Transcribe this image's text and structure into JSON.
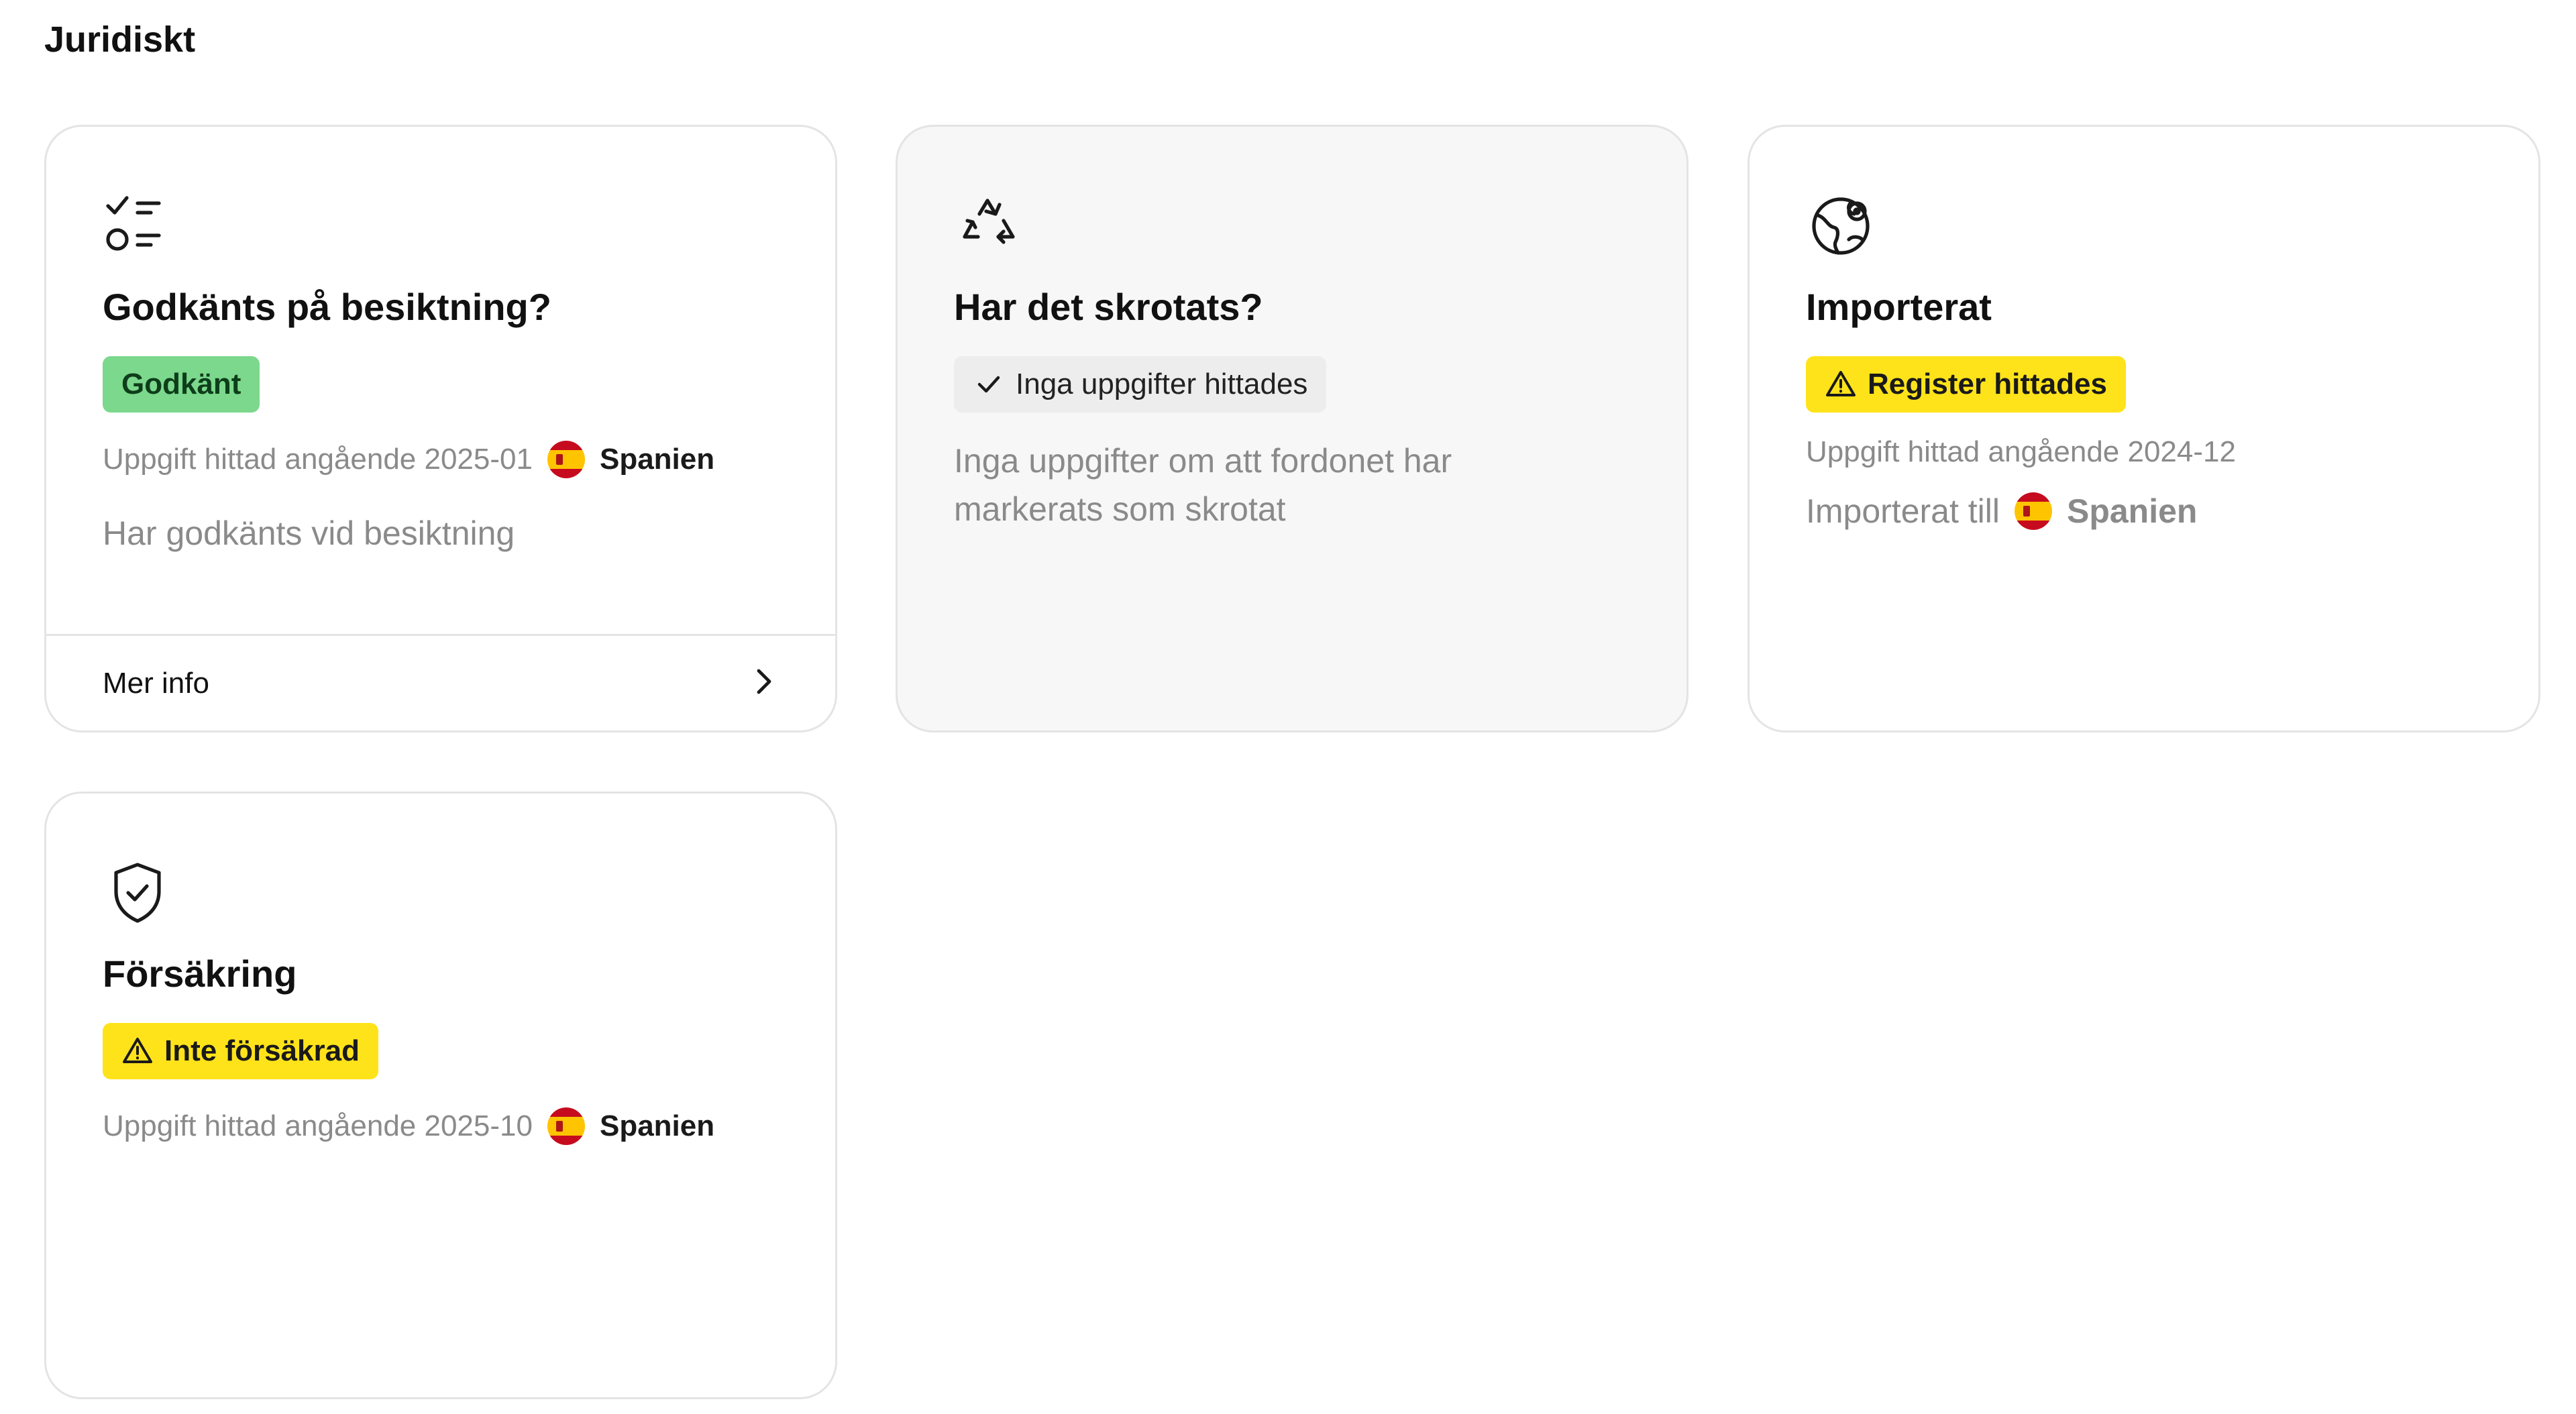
{
  "section": {
    "title": "Juridiskt"
  },
  "cards": [
    {
      "icon": "checklist-icon",
      "title": "Godkänts på besiktning?",
      "badge": "Godkänt",
      "meta_label": "Uppgift hittad angående 2025-01",
      "meta_country": "Spanien",
      "description": "Har godkänts vid besiktning",
      "footer_label": "Mer info"
    },
    {
      "icon": "recycle-icon",
      "title": "Har det skrotats?",
      "badge": "Inga uppgifter hittades",
      "description_line1": "Inga uppgifter om att fordonet har",
      "description_line2": "markerats som skrotat"
    },
    {
      "icon": "globe-icon",
      "title": "Importerat",
      "badge": "Register hittades",
      "meta_label": "Uppgift hittad angående 2024-12",
      "imported_label": "Importerat till",
      "imported_country": "Spanien"
    },
    {
      "icon": "shield-check-icon",
      "title": "Försäkring",
      "badge": "Inte försäkrad",
      "meta_label": "Uppgift hittad angående 2025-10",
      "meta_country": "Spanien"
    }
  ],
  "colors": {
    "green_badge": "#7bd88c",
    "yellow_badge": "#ffe31a",
    "gray_badge": "#ededed",
    "muted_card": "#f7f7f7",
    "border": "#e4e4e4"
  }
}
